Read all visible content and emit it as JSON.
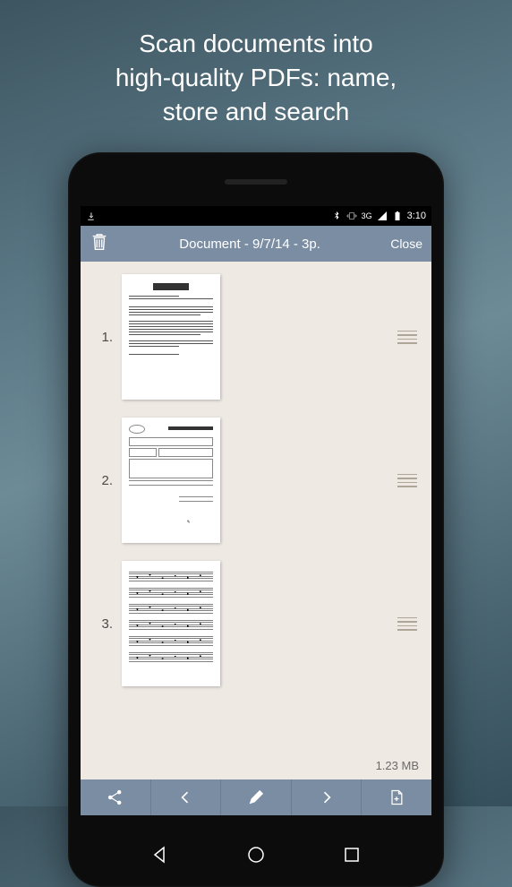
{
  "promo": {
    "line1": "Scan documents into",
    "line2": "high-quality PDFs: name,",
    "line3": "store and search"
  },
  "status": {
    "network": "3G",
    "time": "3:10"
  },
  "appbar": {
    "title": "Document - 9/7/14 - 3p.",
    "close": "Close"
  },
  "pages": [
    {
      "num": "1."
    },
    {
      "num": "2."
    },
    {
      "num": "3."
    }
  ],
  "file_size": "1.23 MB"
}
